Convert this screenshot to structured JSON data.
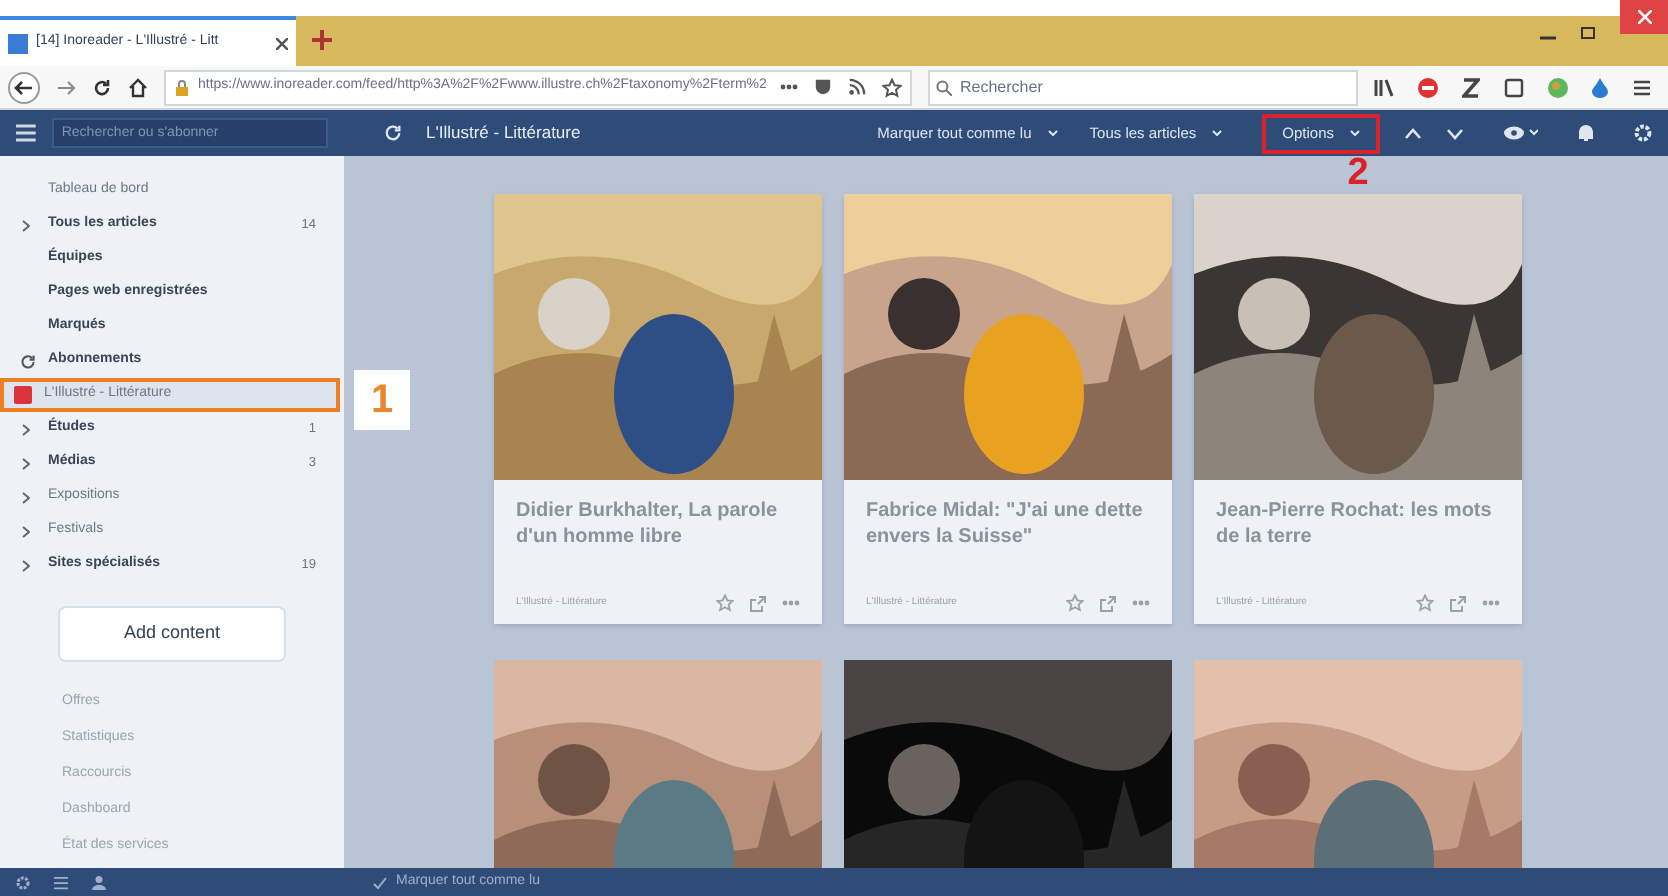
{
  "browser": {
    "tab_title": "[14] Inoreader - L'Illustré - Litt",
    "url": "https://www.inoreader.com/feed/http%3A%2F%2Fwww.illustre.ch%2Ftaxonomy%2Fterm%2",
    "search": {
      "placeholder": "Rechercher"
    }
  },
  "toolbar": {
    "search": {
      "placeholder": "Rechercher ou s'abonner"
    },
    "title": "L'Illustré - Littérature",
    "menus": [
      "Marquer tout comme lu",
      "Tous les articles",
      "Options"
    ]
  },
  "sidebar": {
    "items": [
      {
        "kind": "link",
        "label": "Tableau de bord",
        "unread": false,
        "selected": false
      },
      {
        "kind": "folder",
        "label": "Tous les articles",
        "count": "14",
        "unread": true,
        "selected": false
      },
      {
        "kind": "link",
        "label": "Équipes",
        "unread": true,
        "selected": false
      },
      {
        "kind": "link",
        "label": "Pages web enregistrées",
        "unread": true,
        "selected": false
      },
      {
        "kind": "link",
        "label": "Marqués",
        "unread": true,
        "selected": false
      },
      {
        "kind": "section",
        "label": "Abonnements",
        "unread": true,
        "selected": false
      },
      {
        "kind": "feed",
        "label": "L'Illustré - Littérature",
        "unread": false,
        "selected": true
      },
      {
        "kind": "folder",
        "label": "Études",
        "count": "1",
        "unread": true,
        "selected": false
      },
      {
        "kind": "folder",
        "label": "Médias",
        "count": "3",
        "unread": true,
        "selected": false
      },
      {
        "kind": "folder",
        "label": "Expositions",
        "unread": false,
        "selected": false
      },
      {
        "kind": "folder",
        "label": "Festivals",
        "unread": false,
        "selected": false
      },
      {
        "kind": "folder",
        "label": "Sites spécialisés",
        "count": "19",
        "unread": true,
        "selected": false
      }
    ],
    "add_button": "Add content",
    "footer_links": [
      "Offres",
      "Statistiques",
      "Raccourcis",
      "Dashboard",
      "État des services"
    ]
  },
  "cards": [
    {
      "title": "Didier Burkhalter, La parole d'un homme libre",
      "source": "L'Illustré - Littérature"
    },
    {
      "title": "Fabrice Midal: \"J'ai une dette envers la Suisse\"",
      "source": "L'Illustré - Littérature"
    },
    {
      "title": "Jean-Pierre Rochat: les mots de la terre",
      "source": "L'Illustré - Littérature"
    },
    {
      "kind": "picture"
    },
    {
      "kind": "picture"
    },
    {
      "kind": "picture"
    }
  ],
  "status_bar": {
    "action": "Marquer tout comme lu"
  },
  "annotations": [
    "1",
    "2"
  ]
}
